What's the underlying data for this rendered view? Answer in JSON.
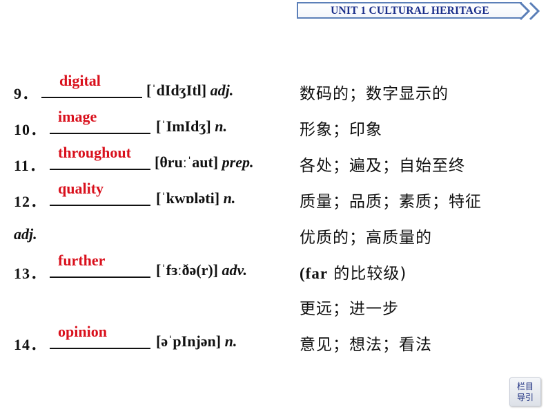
{
  "header": {
    "title": "UNIT 1    CULTURAL HERITAGE",
    "accent_color": "#1a2e8a",
    "border_color": "#5b7fb8"
  },
  "vocab": [
    {
      "num": "9．",
      "answer": "digital",
      "phonetic": "[ˈdIdʒItl]",
      "pos": "adj.",
      "meaning": "数码的；数字显示的"
    },
    {
      "num": "10．",
      "answer": "image",
      "phonetic": "[ˈImIdʒ]",
      "pos": "n.",
      "meaning": "形象；印象"
    },
    {
      "num": "11．",
      "answer": "throughout",
      "phonetic": "[θruːˈaut]",
      "pos": "prep.",
      "meaning": "各处；遍及；自始至终"
    },
    {
      "num": "12．",
      "answer": "quality",
      "phonetic": "[ˈkwɒləti]",
      "pos": "n.",
      "meaning": "质量；品质；素质；特征"
    },
    {
      "pos_extra": "adj.",
      "meaning_extra": "优质的；高质量的"
    },
    {
      "num": "13．",
      "answer": "further",
      "phonetic": "[ˈfɜːðə(r)]",
      "pos": "adv.",
      "meaning_note_word": "(far",
      "meaning_note_rest": " 的比较级)",
      "meaning_extra": "更远；进一步"
    },
    {
      "num": "14．",
      "answer": "opinion",
      "phonetic": "[əˈpInjən]",
      "pos": "n.",
      "meaning": "意见；想法；看法"
    }
  ],
  "answer_color": "#d9101c",
  "nav_button": {
    "line1": "栏目",
    "line2": "导引"
  }
}
